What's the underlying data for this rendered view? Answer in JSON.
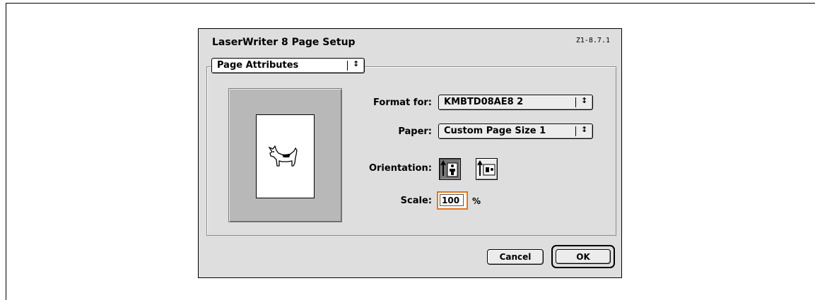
{
  "dialog": {
    "title": "LaserWriter 8 Page Setup",
    "version": "Z1-8.7.1"
  },
  "page_type_popup": {
    "selected": "Page Attributes"
  },
  "format_for": {
    "label": "Format for:",
    "selected": "KMBTD08AE8 2"
  },
  "paper": {
    "label": "Paper:",
    "selected": "Custom Page Size 1"
  },
  "orientation": {
    "label": "Orientation:",
    "selected": "portrait"
  },
  "scale": {
    "label": "Scale:",
    "value": "100",
    "unit": "%"
  },
  "buttons": {
    "cancel": "Cancel",
    "ok": "OK"
  },
  "icons": {
    "popup_arrows": "up-down-arrows-icon",
    "preview": "dogcow-icon",
    "portrait": "portrait-orientation-icon",
    "landscape": "landscape-orientation-icon"
  },
  "colors": {
    "focus_ring": "#e0781c",
    "dialog_bg": "#dedede"
  }
}
